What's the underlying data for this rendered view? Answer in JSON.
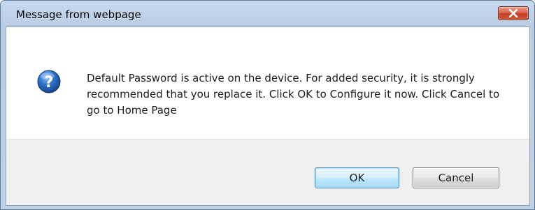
{
  "window": {
    "title": "Message from webpage"
  },
  "dialog": {
    "icon": "question-icon",
    "message": "Default Password is active on the device. For added security, it is strongly recommended that you replace it. Click OK to Configure it now. Click Cancel to go to Home Page"
  },
  "buttons": {
    "ok_label": "OK",
    "cancel_label": "Cancel"
  },
  "colors": {
    "title_bar": "#bed2e8",
    "close_button": "#c33d21",
    "icon_blue": "#1f5fb0",
    "ok_button_border": "#3c7fb1",
    "button_bar": "#f0f0f0"
  }
}
